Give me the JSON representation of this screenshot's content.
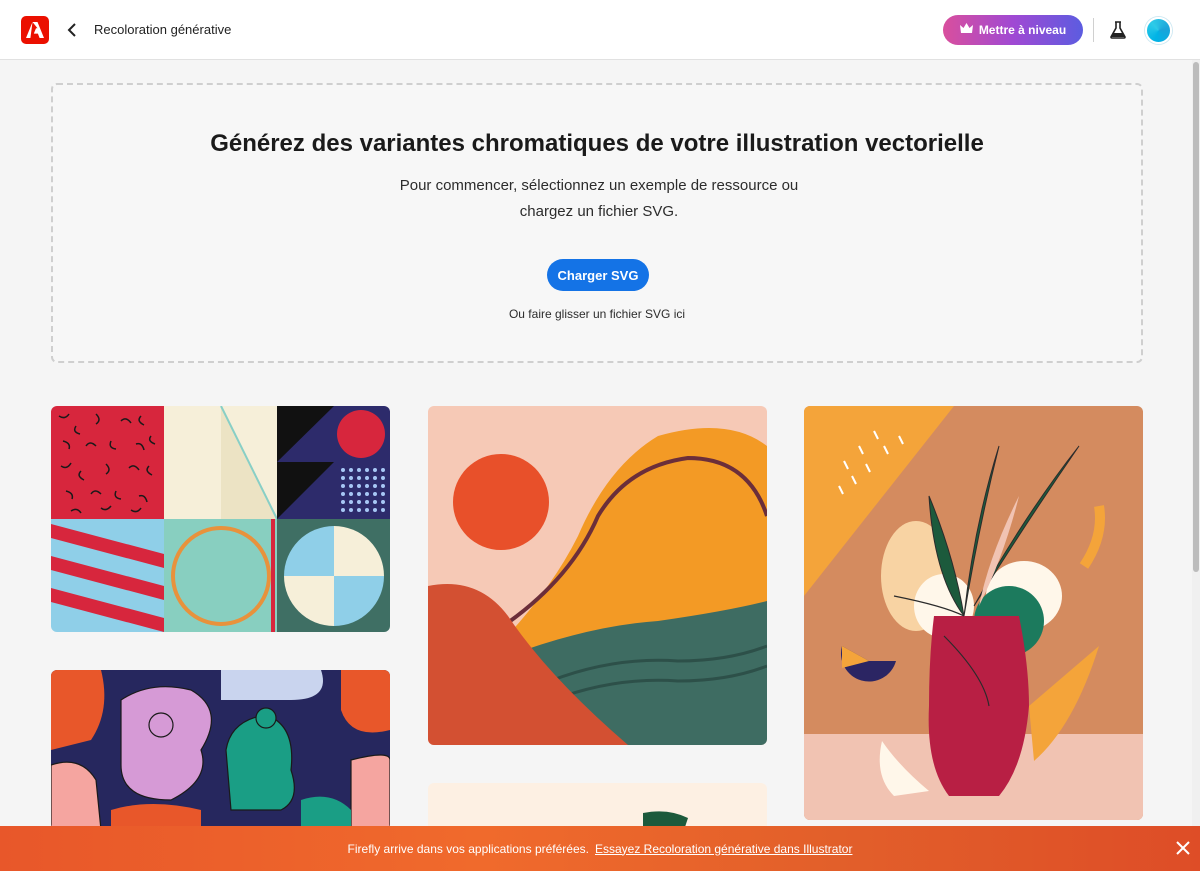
{
  "header": {
    "app_title": "Recoloration générative",
    "upgrade_label": "Mettre à niveau",
    "logo_icon": "adobe-logo-icon",
    "back_icon": "chevron-left-icon",
    "labs_icon": "flask-icon",
    "crown_icon": "crown-icon"
  },
  "dropzone": {
    "heading": "Générez des variantes chromatiques de votre illustration vectorielle",
    "subtext": "Pour commencer, sélectionnez un exemple de ressource ou chargez un fichier SVG.",
    "upload_label": "Charger SVG",
    "drag_hint": "Ou faire glisser un fichier SVG ici"
  },
  "samples": [
    {
      "name": "geometric-patterns-sample"
    },
    {
      "name": "landscape-sample"
    },
    {
      "name": "plant-vase-sample"
    },
    {
      "name": "characters-sample"
    },
    {
      "name": "leaf-sample"
    }
  ],
  "banner": {
    "text": "Firefly arrive dans vos applications préférées.",
    "link": "Essayez Recoloration générative dans Illustrator",
    "close_icon": "close-icon"
  },
  "colors": {
    "brand": "#eb1000",
    "accent": "#1473e6",
    "banner": "#e8572a"
  }
}
